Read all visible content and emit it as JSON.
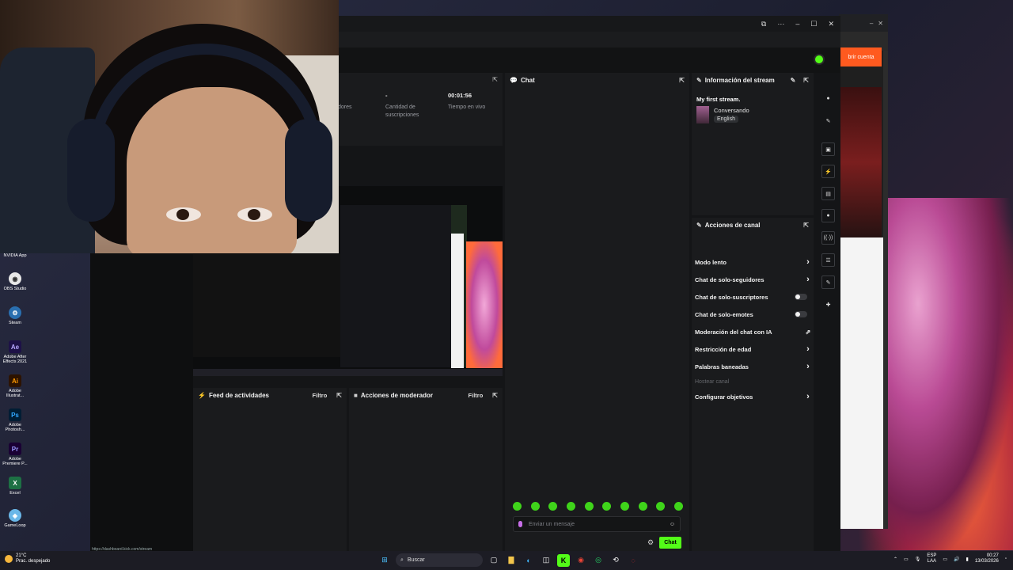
{
  "colors": {
    "kick_green": "#53fc18",
    "panel_bg": "#1a1b1d",
    "window_bg": "#141517",
    "taskbar_bg": "#1c1c24"
  },
  "desktop_icons": [
    {
      "label": "NVIDIA App",
      "icon": "nvidia-icon"
    },
    {
      "label": "OBS Studio",
      "icon": "obs-icon",
      "glyph": "◉",
      "color": "#e8e8e8"
    },
    {
      "label": "Steam",
      "icon": "steam-icon",
      "glyph": "⚙",
      "color": "#2a6fb0"
    },
    {
      "label": "Adobe After Effects 2021",
      "icon": "after-effects-icon",
      "glyph": "Ae",
      "color": "#1d1147"
    },
    {
      "label": "Adobe Illustrat...",
      "icon": "illustrator-icon",
      "glyph": "Ai",
      "color": "#2d1300"
    },
    {
      "label": "Adobe Photosh...",
      "icon": "photoshop-icon",
      "glyph": "Ps",
      "color": "#001d34"
    },
    {
      "label": "Adobe Premiere P...",
      "icon": "premiere-icon",
      "glyph": "Pr",
      "color": "#1a0034"
    },
    {
      "label": "Excel",
      "icon": "excel-icon",
      "glyph": "X",
      "color": "#1d7044"
    },
    {
      "label": "GameLoop",
      "icon": "gameloop-icon",
      "glyph": "◈",
      "color": "#6ab7e8"
    }
  ],
  "browser": {
    "orange_button": "brir cuenta"
  },
  "stats": {
    "followers_label": "dores",
    "subs_value": "-",
    "subs_label_1": "Cantidad de",
    "subs_label_2": "suscripciones",
    "time_value": "00:01:56",
    "time_label": "Tiempo en vivo"
  },
  "chat": {
    "title": "Chat",
    "placeholder": "Enviar un mensaje",
    "send_label": "Chat"
  },
  "stream_info": {
    "header": "Información del stream",
    "title": "My first stream.",
    "category": "Conversando",
    "language": "English"
  },
  "channel_actions": {
    "header": "Acciones de canal",
    "items": [
      {
        "label": "Modo lento",
        "control": "chevron"
      },
      {
        "label": "Chat de solo-seguidores",
        "control": "chevron"
      },
      {
        "label": "Chat de solo-suscriptores",
        "control": "toggle"
      },
      {
        "label": "Chat de solo-emotes",
        "control": "toggle"
      },
      {
        "label": "Moderación del chat con IA",
        "control": "external"
      },
      {
        "label": "Restricción de edad",
        "control": "chevron"
      },
      {
        "label": "Palabras baneadas",
        "control": "chevron"
      },
      {
        "label": "Hostear canal",
        "control": "none"
      },
      {
        "label": "Configurar objetivos",
        "control": "chevron"
      }
    ]
  },
  "feed": {
    "title": "Feed de actividades",
    "filter": "Filtro"
  },
  "mod_actions": {
    "title": "Acciones de moderador",
    "filter": "Filtro"
  },
  "status_url": "https://dashboard.kick.com/stream",
  "taskbar": {
    "weather_temp": "21°C",
    "weather_desc": "Prac. despejado",
    "search_placeholder": "Buscar",
    "lang_1": "ESP",
    "lang_2": "LAA",
    "time": "00:27",
    "date": "13/03/2026"
  }
}
